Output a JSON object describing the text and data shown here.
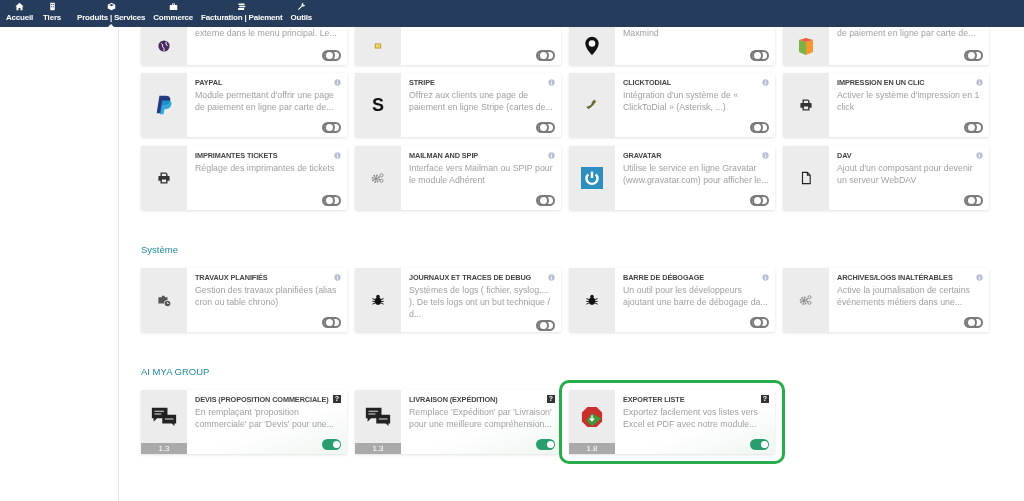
{
  "nav": [
    {
      "label": "Accueil",
      "kind": "home",
      "selected": false
    },
    {
      "label": "Tiers",
      "kind": "building",
      "selected": false
    },
    {
      "label": "Produits | Services",
      "kind": "cube",
      "selected": true
    },
    {
      "label": "Commerce",
      "kind": "briefcase",
      "selected": false
    },
    {
      "label": "Facturation | Paiement",
      "kind": "coins",
      "selected": false
    },
    {
      "label": "Outils",
      "kind": "wrench",
      "selected": false
    }
  ],
  "scrolled_top_row": [
    {
      "description": "externe dans le menu principal. Le...",
      "kind": "globe",
      "enabled": false
    },
    {
      "kind": "note",
      "enabled": false
    },
    {
      "description": "Maxmind",
      "kind": "pin",
      "enabled": false
    },
    {
      "description": "de paiement en ligne par carte de...",
      "kind": "box",
      "enabled": false
    }
  ],
  "sections": [
    {
      "modules": [
        {
          "title": "PAYPAL",
          "description": "Module permettant d'offrir une page de paiement en ligne par carte de...",
          "kind": "paypal",
          "enabled": false,
          "help": {
            "kind": "info"
          },
          "highlighted": false
        },
        {
          "title": "STRIPE",
          "description": "Offrez aux clients une page de paiement en ligne Stripe (cartes de...",
          "kind": "letter",
          "icon_text": "S",
          "enabled": false,
          "help": {
            "kind": "info"
          },
          "highlighted": false
        },
        {
          "title": "CLICKTODIAL",
          "description": "Intégration d'un système de « ClickToDial » (Asterisk, ...)",
          "kind": "phone",
          "enabled": false,
          "help": {
            "kind": "info"
          },
          "highlighted": false
        },
        {
          "title": "IMPRESSION EN UN CLIC",
          "description": "Activer le système d'impression en 1 click",
          "kind": "printer",
          "enabled": false,
          "help": {
            "kind": "info"
          },
          "highlighted": false
        },
        {
          "title": "IMPRIMANTES TICKETS",
          "description": "Réglage des imprimantes de tickets",
          "kind": "printer",
          "enabled": false,
          "help": {
            "kind": "info"
          },
          "highlighted": false
        },
        {
          "title": "MAILMAN AND SPIP",
          "description": "Interface vers Mailman ou SPIP pour le module Adhérent",
          "kind": "gears",
          "enabled": false,
          "help": {
            "kind": "info"
          },
          "highlighted": false
        },
        {
          "title": "GRAVATAR",
          "description": "Utilise le service en ligne Gravatar (www.gravatar.com) pour afficher le...",
          "kind": "power",
          "enabled": false,
          "help": {
            "kind": "info"
          },
          "highlighted": false
        },
        {
          "title": "DAV",
          "description": "Ajout d'un composant pour devenir un serveur WebDAV",
          "kind": "file",
          "enabled": false,
          "help": {
            "kind": "info"
          },
          "highlighted": false
        }
      ]
    },
    {
      "title": "Système",
      "modules": [
        {
          "title": "TRAVAUX PLANIFIÉS",
          "description": "Gestion des travaux planifiées (alias cron ou table chrono)",
          "kind": "briefcase-clock",
          "enabled": false,
          "help": {
            "kind": "info"
          },
          "highlighted": false
        },
        {
          "title": "JOURNAUX ET TRACES DE DEBUG",
          "description": "Systèmes de logs ( fichier, syslog,... ). De tels logs ont un but technique / d...",
          "kind": "bug",
          "enabled": false,
          "help": {
            "kind": "info"
          },
          "highlighted": false
        },
        {
          "title": "BARRE DE DÉBOGAGE",
          "description": "Un outil pour les développeurs ajoutant une barre de débogage da...",
          "kind": "bug",
          "enabled": false,
          "help": {
            "kind": "info"
          },
          "highlighted": false
        },
        {
          "title": "ARCHIVES/LOGS INALTÉRABLES",
          "description": "Active la journalisation de certains événements métiers dans une...",
          "kind": "gears",
          "enabled": false,
          "help": {
            "kind": "info"
          },
          "highlighted": false
        }
      ]
    },
    {
      "title": "AI MYA GROUP",
      "modules": [
        {
          "title": "DEVIS (PROPOSITION COMMERCIALE)",
          "description": "En remplaçant 'proposition commerciale' par 'Devis' pour une...",
          "kind": "chat",
          "version": "1.3",
          "enabled": true,
          "help": {
            "kind": "question",
            "char": "?"
          },
          "highlighted": false
        },
        {
          "title": "LIVRAISON (EXPÉDITION)",
          "description": "Remplace 'Expédition' par 'Livraison' pour une meilleure compréhension...",
          "kind": "chat",
          "version": "1.3",
          "enabled": true,
          "help": {
            "kind": "question",
            "char": "?"
          },
          "highlighted": false
        },
        {
          "title": "EXPORTER LISTE",
          "description": "Exportez facilement vos listes vers Excel et PDF avec notre module...",
          "kind": "pdf",
          "version": "1.8",
          "enabled": true,
          "help": {
            "kind": "question",
            "char": "?"
          },
          "highlighted": true
        }
      ]
    }
  ]
}
